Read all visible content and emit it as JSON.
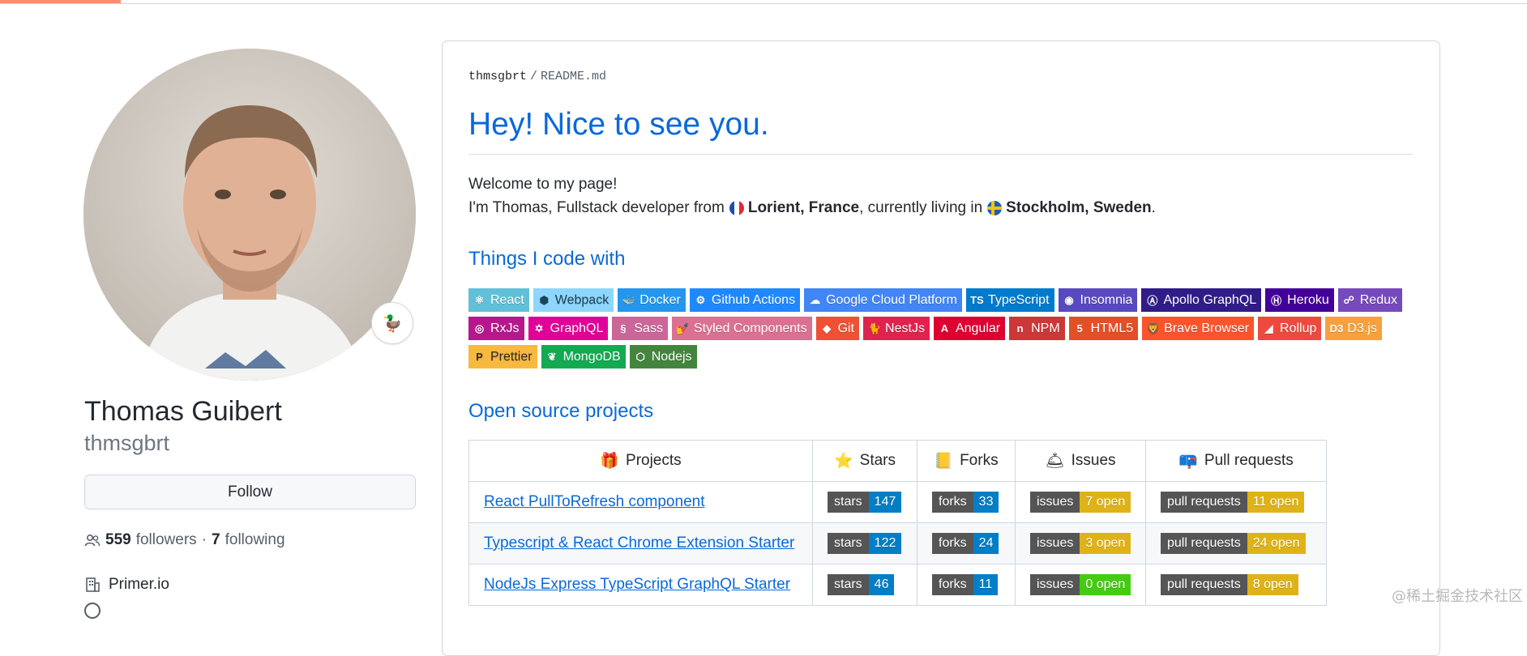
{
  "profile": {
    "name": "Thomas Guibert",
    "login": "thmsgbrt",
    "status_emoji": "🦆",
    "follow_label": "Follow",
    "followers_count": "559",
    "followers_label": "followers",
    "following_separator": "·",
    "following_count": "7",
    "following_label": "following",
    "organization": "Primer.io"
  },
  "readme": {
    "breadcrumb_user": "thmsgbrt",
    "breadcrumb_separator": "/",
    "breadcrumb_file": "README.md",
    "title": "Hey! Nice to see you.",
    "welcome": "Welcome to my page!",
    "intro_before": "I'm Thomas, Fullstack developer from",
    "from_place": "Lorient, France",
    "intro_middle": ", currently living in",
    "current_place": "Stockholm, Sweden",
    "intro_end": ".",
    "skills_heading": "Things I code with",
    "projects_heading": "Open source projects"
  },
  "badges": [
    {
      "label": "React",
      "icon": "react-icon",
      "glyph": "⚛",
      "color": "#61c0d8"
    },
    {
      "label": "Webpack",
      "icon": "webpack-icon",
      "glyph": "⬢",
      "color": "#8ed6fb",
      "text_color": "#1c4458"
    },
    {
      "label": "Docker",
      "icon": "docker-icon",
      "glyph": "🐳",
      "color": "#2496ed"
    },
    {
      "label": "Github Actions",
      "icon": "github-actions-icon",
      "glyph": "⚙",
      "color": "#2088ff"
    },
    {
      "label": "Google Cloud Platform",
      "icon": "google-cloud-icon",
      "glyph": "☁",
      "color": "#4285f4"
    },
    {
      "label": "TypeScript",
      "icon": "typescript-icon",
      "glyph": "TS",
      "color": "#007acc"
    },
    {
      "label": "Insomnia",
      "icon": "insomnia-icon",
      "glyph": "◉",
      "color": "#5849be"
    },
    {
      "label": "Apollo GraphQL",
      "icon": "apollo-icon",
      "glyph": "Ⓐ",
      "color": "#311c87"
    },
    {
      "label": "Heroku",
      "icon": "heroku-icon",
      "glyph": "Ⓗ",
      "color": "#430098"
    },
    {
      "label": "Redux",
      "icon": "redux-icon",
      "glyph": "☍",
      "color": "#764abc"
    },
    {
      "label": "RxJs",
      "icon": "rxjs-icon",
      "glyph": "◎",
      "color": "#b7178c"
    },
    {
      "label": "GraphQL",
      "icon": "graphql-icon",
      "glyph": "✡",
      "color": "#e10098"
    },
    {
      "label": "Sass",
      "icon": "sass-icon",
      "glyph": "§",
      "color": "#cc6699"
    },
    {
      "label": "Styled Components",
      "icon": "styled-components-icon",
      "glyph": "💅",
      "color": "#db7093"
    },
    {
      "label": "Git",
      "icon": "git-icon",
      "glyph": "◆",
      "color": "#f05033"
    },
    {
      "label": "NestJs",
      "icon": "nestjs-icon",
      "glyph": "🐈",
      "color": "#e0234e"
    },
    {
      "label": "Angular",
      "icon": "angular-icon",
      "glyph": "A",
      "color": "#dd0031"
    },
    {
      "label": "NPM",
      "icon": "npm-icon",
      "glyph": "n",
      "color": "#cb3837"
    },
    {
      "label": "HTML5",
      "icon": "html5-icon",
      "glyph": "5",
      "color": "#e34f26"
    },
    {
      "label": "Brave Browser",
      "icon": "brave-icon",
      "glyph": "🦁",
      "color": "#fb542b"
    },
    {
      "label": "Rollup",
      "icon": "rollup-icon",
      "glyph": "◢",
      "color": "#ec4a3f"
    },
    {
      "label": "D3.js",
      "icon": "d3-icon",
      "glyph": "D3",
      "color": "#f9a03c"
    },
    {
      "label": "Prettier",
      "icon": "prettier-icon",
      "glyph": "P",
      "color": "#f7b93e",
      "text_color": "#2d2d2d"
    },
    {
      "label": "MongoDB",
      "icon": "mongodb-icon",
      "glyph": "❦",
      "color": "#13aa52"
    },
    {
      "label": "Nodejs",
      "icon": "nodejs-icon",
      "glyph": "⬡",
      "color": "#43853d"
    }
  ],
  "projects_table": {
    "headers": [
      {
        "label": "Projects",
        "icon": "gift-icon",
        "glyph": "🎁"
      },
      {
        "label": "Stars",
        "icon": "star-icon",
        "glyph": "⭐"
      },
      {
        "label": "Forks",
        "icon": "ledger-icon",
        "glyph": "📒"
      },
      {
        "label": "Issues",
        "icon": "bell-icon",
        "glyph": "🛎"
      },
      {
        "label": "Pull requests",
        "icon": "mailbox-icon",
        "glyph": "📪"
      }
    ],
    "rows": [
      {
        "project": "React PullToRefresh component",
        "stars": {
          "label": "stars",
          "value": "147",
          "color": "#007ec6"
        },
        "forks": {
          "label": "forks",
          "value": "33",
          "color": "#007ec6"
        },
        "issues": {
          "label": "issues",
          "value": "7 open",
          "color": "#dfb317"
        },
        "pulls": {
          "label": "pull requests",
          "value": "11 open",
          "color": "#dfb317"
        }
      },
      {
        "project": "Typescript & React Chrome Extension Starter",
        "stars": {
          "label": "stars",
          "value": "122",
          "color": "#007ec6"
        },
        "forks": {
          "label": "forks",
          "value": "24",
          "color": "#007ec6"
        },
        "issues": {
          "label": "issues",
          "value": "3 open",
          "color": "#dfb317"
        },
        "pulls": {
          "label": "pull requests",
          "value": "24 open",
          "color": "#dfb317"
        }
      },
      {
        "project": "NodeJs Express TypeScript GraphQL Starter",
        "stars": {
          "label": "stars",
          "value": "46",
          "color": "#007ec6"
        },
        "forks": {
          "label": "forks",
          "value": "11",
          "color": "#007ec6"
        },
        "issues": {
          "label": "issues",
          "value": "0 open",
          "color": "#4c1"
        },
        "pulls": {
          "label": "pull requests",
          "value": "8 open",
          "color": "#dfb317"
        }
      }
    ]
  },
  "watermark": "@稀土掘金技术社区"
}
